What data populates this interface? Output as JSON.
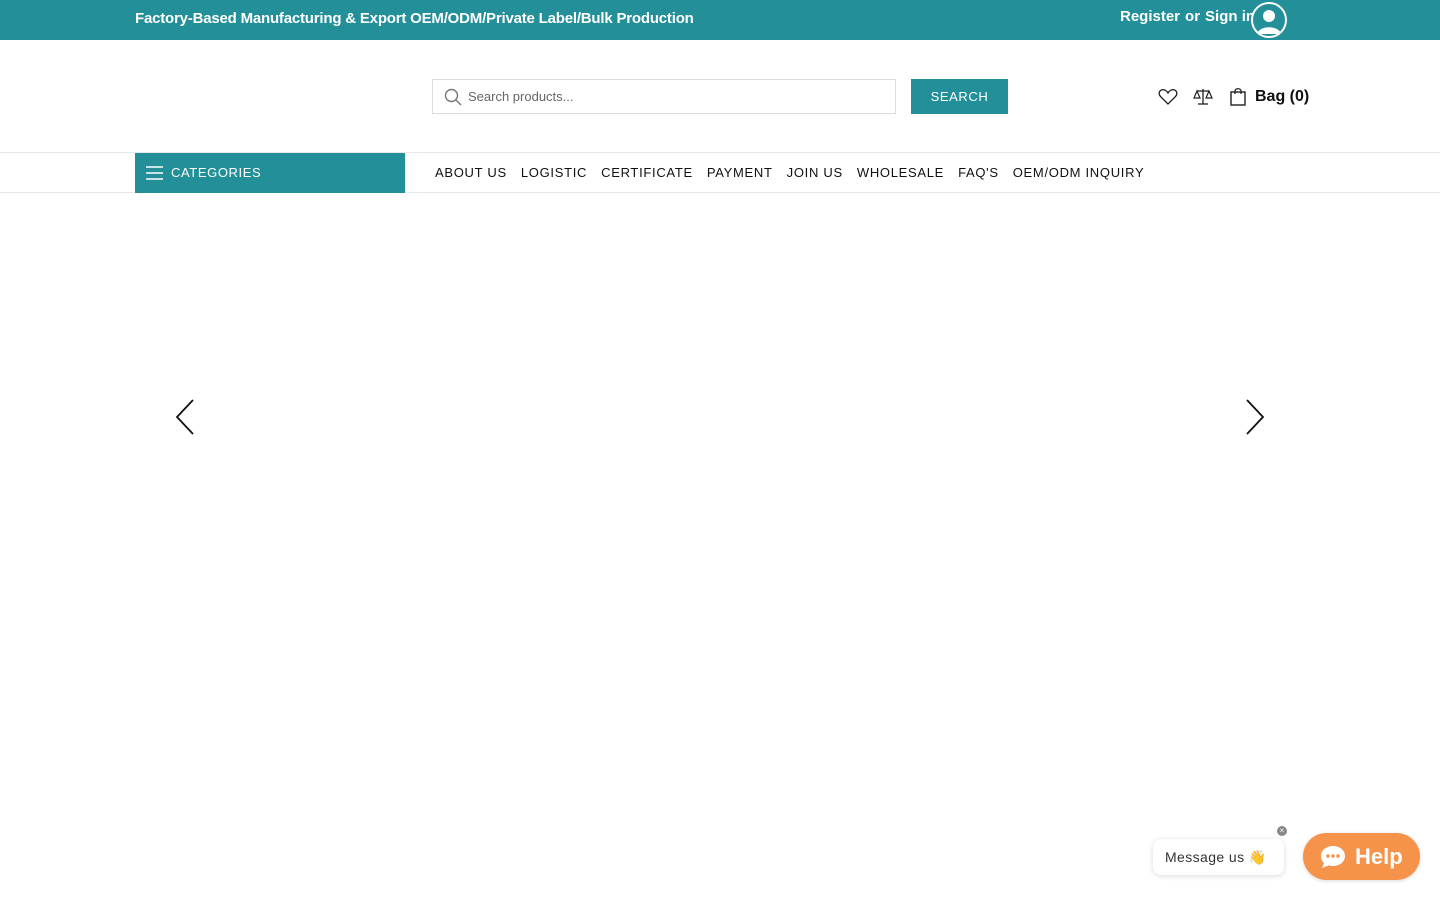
{
  "topbar": {
    "tagline": "Factory-Based Manufacturing & Export OEM/ODM/Private Label/Bulk Production",
    "register_label": "Register",
    "or_label": "or",
    "signin_label": "Sign in"
  },
  "search": {
    "placeholder": "Search products...",
    "button_label": "SEARCH"
  },
  "header": {
    "wishlist_icon": "heart-icon",
    "compare_icon": "scale-icon",
    "bag_icon": "shopping-bag-icon",
    "bag_label": "Bag (0)"
  },
  "nav": {
    "categories_label": "CATEGORIES",
    "links": [
      "ABOUT US",
      "LOGISTIC",
      "CERTIFICATE",
      "PAYMENT",
      "JOIN US",
      "WHOLESALE",
      "FAQ'S",
      "OEM/ODM INQUIRY"
    ]
  },
  "chat": {
    "bubble_text": "Message us 👋",
    "close_label": "×",
    "help_label": "Help"
  },
  "colors": {
    "brand": "#238f99",
    "help_button": "#f5934a"
  }
}
